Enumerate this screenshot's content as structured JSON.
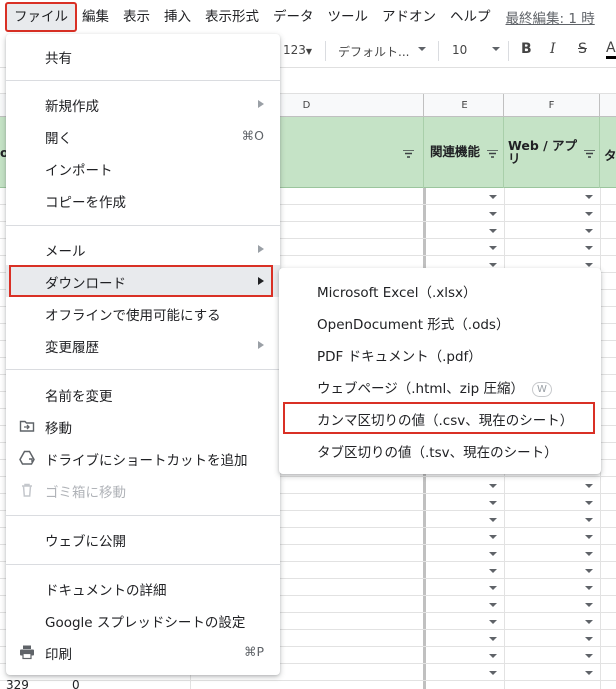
{
  "menubar": {
    "items": [
      "ファイル",
      "編集",
      "表示",
      "挿入",
      "表示形式",
      "データ",
      "ツール",
      "アドオン",
      "ヘルプ"
    ],
    "active_index": 0,
    "last_edit": "最終編集: 1 時"
  },
  "toolbar": {
    "number_format": "123",
    "font": "デフォルト...",
    "font_size": "10",
    "bold": "B",
    "italic": "I",
    "strike": "S",
    "text_color": "A"
  },
  "grid": {
    "column_letters": [
      "D",
      "E",
      "F"
    ],
    "header_cells": [
      "関連機能",
      "Web / アプリ",
      "タ"
    ],
    "first_col_partial": "o",
    "last_row_number": "329",
    "last_row_value": "0",
    "header_color": "#c5e3c6"
  },
  "file_menu": {
    "items": [
      {
        "label": "共有"
      },
      {
        "label": "新規作成",
        "submenu": true
      },
      {
        "label": "開く",
        "shortcut": "⌘O"
      },
      {
        "label": "インポート"
      },
      {
        "label": "コピーを作成"
      },
      {
        "label": "メール",
        "submenu": true
      },
      {
        "label": "ダウンロード",
        "submenu": true,
        "highlighted": true
      },
      {
        "label": "オフラインで使用可能にする"
      },
      {
        "label": "変更履歴",
        "submenu": true
      },
      {
        "label": "名前を変更"
      },
      {
        "label": "移動",
        "icon": "move-folder-icon"
      },
      {
        "label": "ドライブにショートカットを追加",
        "icon": "drive-shortcut-icon"
      },
      {
        "label": "ゴミ箱に移動",
        "icon": "trash-icon",
        "disabled": true
      },
      {
        "label": "ウェブに公開"
      },
      {
        "label": "ドキュメントの詳細"
      },
      {
        "label": "Google スプレッドシートの設定"
      },
      {
        "label": "印刷",
        "icon": "print-icon",
        "shortcut": "⌘P"
      }
    ]
  },
  "download_menu": {
    "items": [
      {
        "label": "Microsoft Excel（.xlsx）"
      },
      {
        "label": "OpenDocument 形式（.ods）"
      },
      {
        "label": "PDF ドキュメント（.pdf）"
      },
      {
        "label": "ウェブページ（.html、zip 圧縮）",
        "badge": "W"
      },
      {
        "label": "カンマ区切りの値（.csv、現在のシート）",
        "highlighted": true
      },
      {
        "label": "タブ区切りの値（.tsv、現在のシート）"
      }
    ]
  },
  "colors": {
    "highlight_outline": "#d93025",
    "menu_hover": "#e8eaed"
  }
}
